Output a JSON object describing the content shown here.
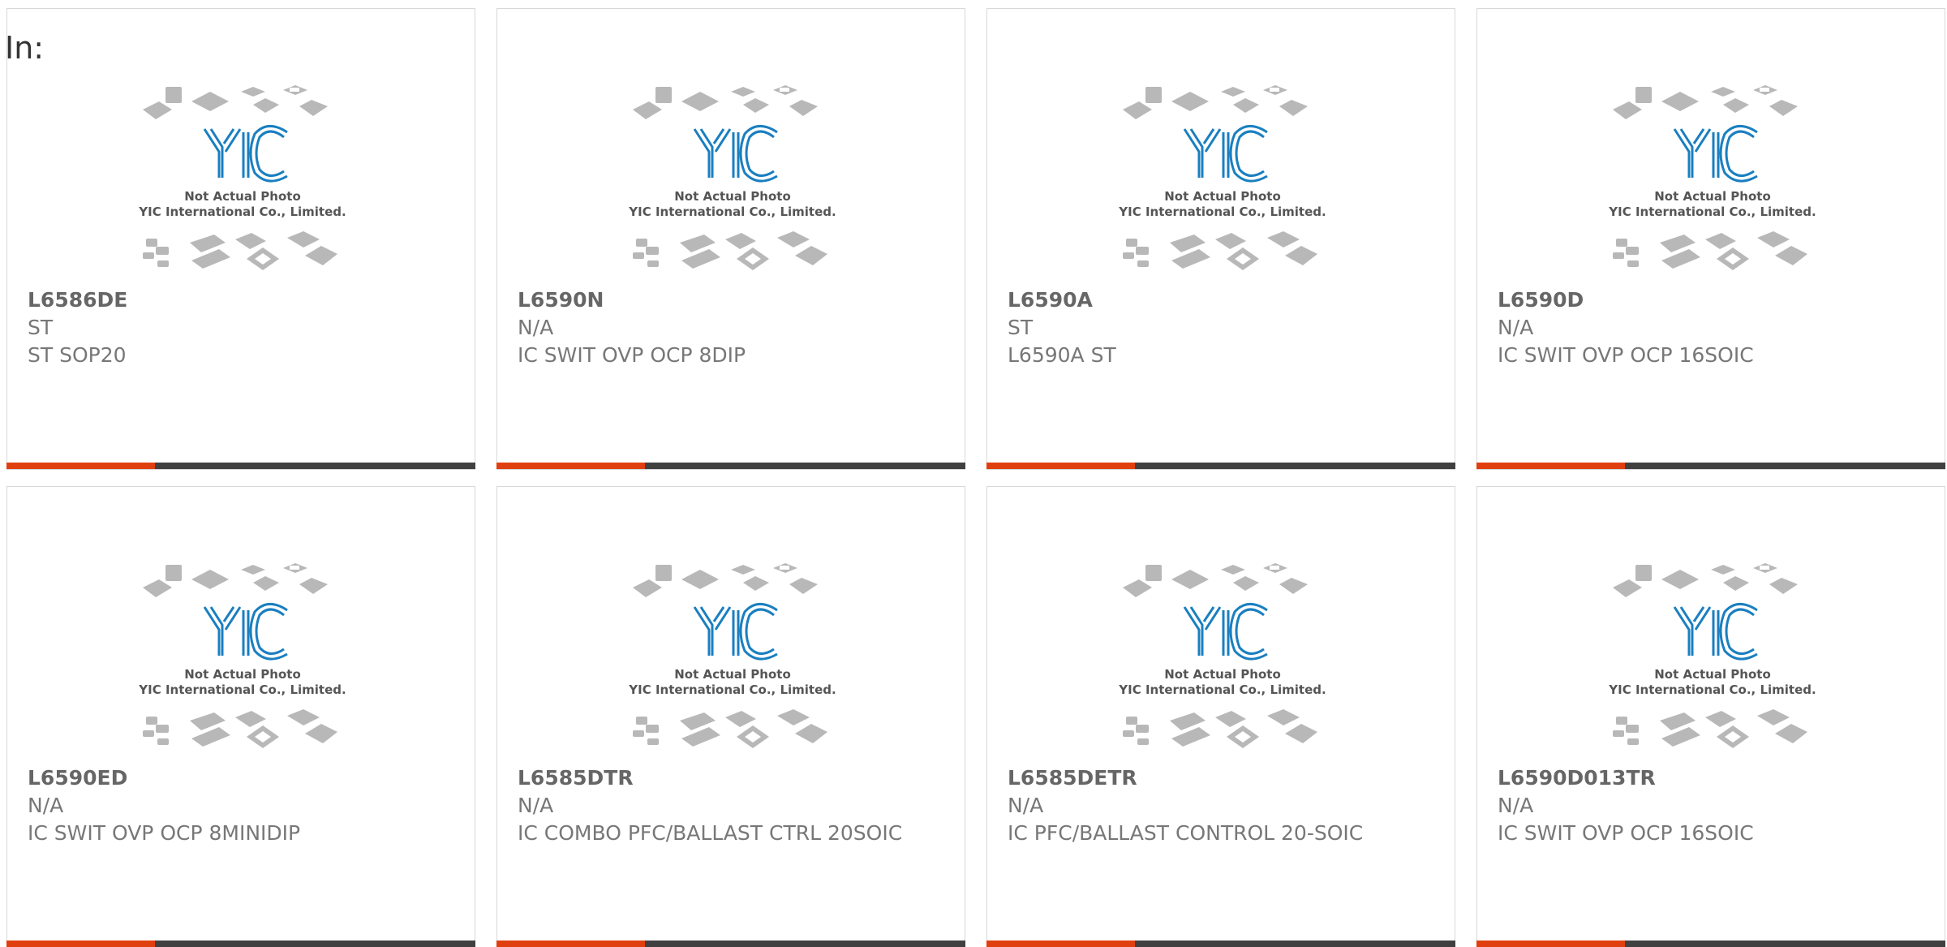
{
  "header": {
    "label": "In:"
  },
  "placeholder": {
    "line1": "Not Actual Photo",
    "line2": "YIC International Co., Limited."
  },
  "colors": {
    "accent": "#e0400f",
    "bar": "#404040",
    "logo": "#1a7fc0",
    "text": "#777777"
  },
  "products": [
    {
      "part": "L6586DE",
      "manufacturer": "ST",
      "description": "ST SOP20"
    },
    {
      "part": "L6590N",
      "manufacturer": "N/A",
      "description": "IC SWIT OVP OCP 8DIP"
    },
    {
      "part": "L6590A",
      "manufacturer": "ST",
      "description": "L6590A ST"
    },
    {
      "part": "L6590D",
      "manufacturer": "N/A",
      "description": "IC SWIT OVP OCP 16SOIC"
    },
    {
      "part": "L6590ED",
      "manufacturer": "N/A",
      "description": "IC SWIT OVP OCP 8MINIDIP"
    },
    {
      "part": "L6585DTR",
      "manufacturer": "N/A",
      "description": "IC COMBO PFC/BALLAST CTRL 20SOIC"
    },
    {
      "part": "L6585DETR",
      "manufacturer": "N/A",
      "description": "IC PFC/BALLAST CONTROL 20-SOIC"
    },
    {
      "part": "L6590D013TR",
      "manufacturer": "N/A",
      "description": "IC SWIT OVP OCP 16SOIC"
    }
  ]
}
